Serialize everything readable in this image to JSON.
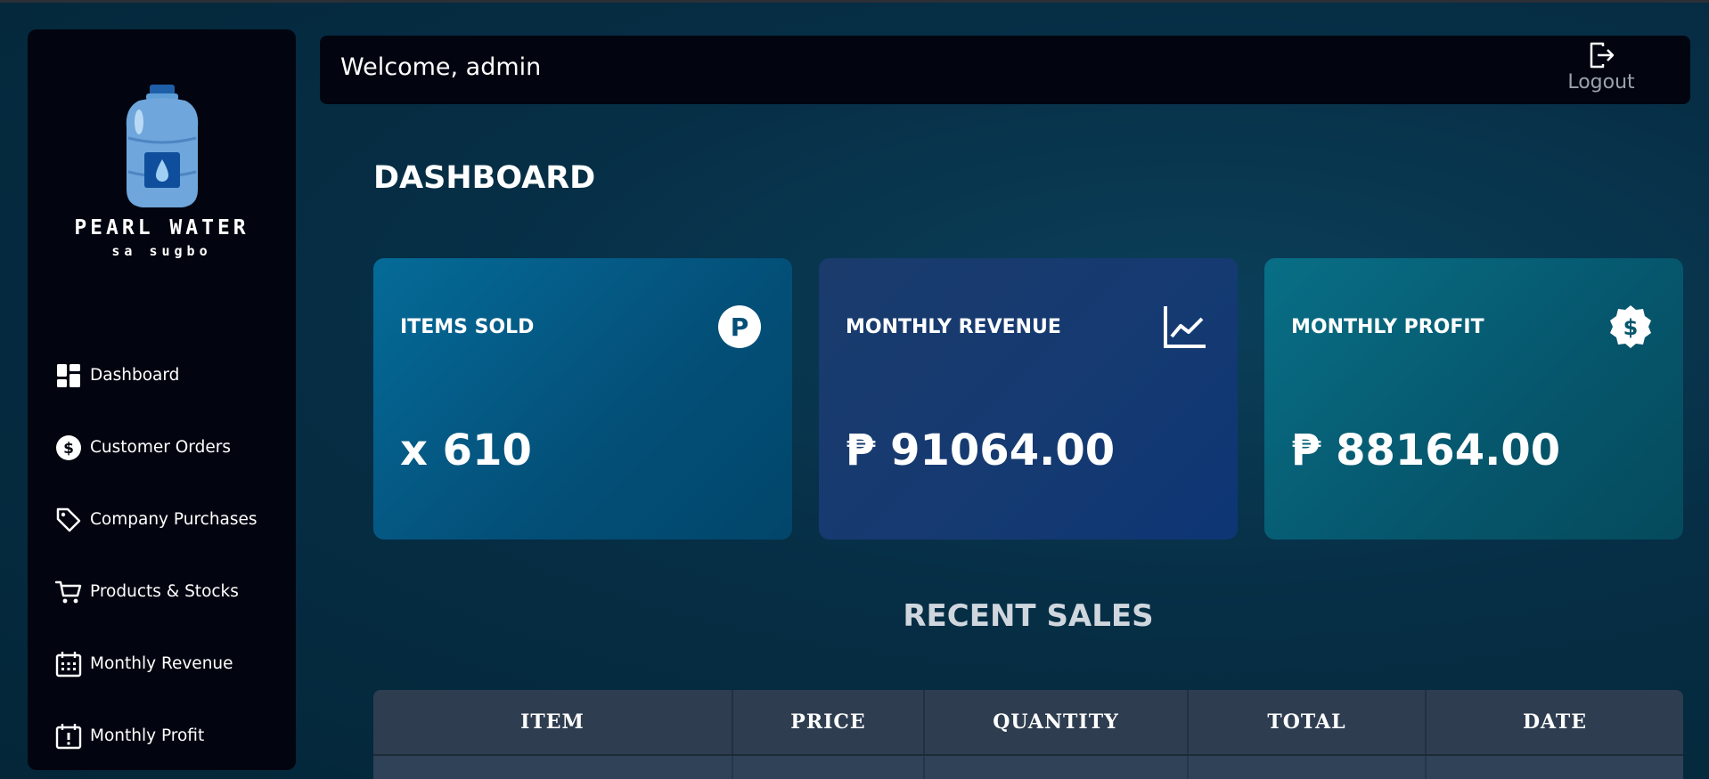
{
  "sidebar": {
    "brand": "PEARL WATER",
    "brand_sub": "sa sugbo",
    "items": [
      {
        "label": "Dashboard",
        "icon": "dashboard-icon"
      },
      {
        "label": "Customer Orders",
        "icon": "dollar-circle-icon"
      },
      {
        "label": "Company Purchases",
        "icon": "tag-icon"
      },
      {
        "label": "Products & Stocks",
        "icon": "cart-icon"
      },
      {
        "label": "Monthly Revenue",
        "icon": "calendar-icon"
      },
      {
        "label": "Monthly Profit",
        "icon": "calendar-alert-icon"
      }
    ]
  },
  "header": {
    "welcome": "Welcome, admin",
    "logout_label": "Logout",
    "logout_icon": "logout-icon"
  },
  "main": {
    "title": "DASHBOARD",
    "cards": [
      {
        "label": "ITEMS SOLD",
        "value": "x 610",
        "icon": "peso-circle-icon"
      },
      {
        "label": "MONTHLY REVENUE",
        "value": "₱ 91064.00",
        "icon": "line-chart-icon"
      },
      {
        "label": "MONTHLY PROFIT",
        "value": "₱ 88164.00",
        "icon": "dollar-badge-icon"
      }
    ],
    "recent_sales": {
      "title": "RECENT SALES",
      "columns": [
        "ITEM",
        "PRICE",
        "QUANTITY",
        "TOTAL",
        "DATE"
      ]
    }
  },
  "colors": {
    "background": "#062e45",
    "sidebar": "#020510",
    "card_items_sold": "#056b98",
    "card_revenue": "#153a72",
    "card_profit": "#086f86",
    "table_header": "#2e3d50"
  }
}
